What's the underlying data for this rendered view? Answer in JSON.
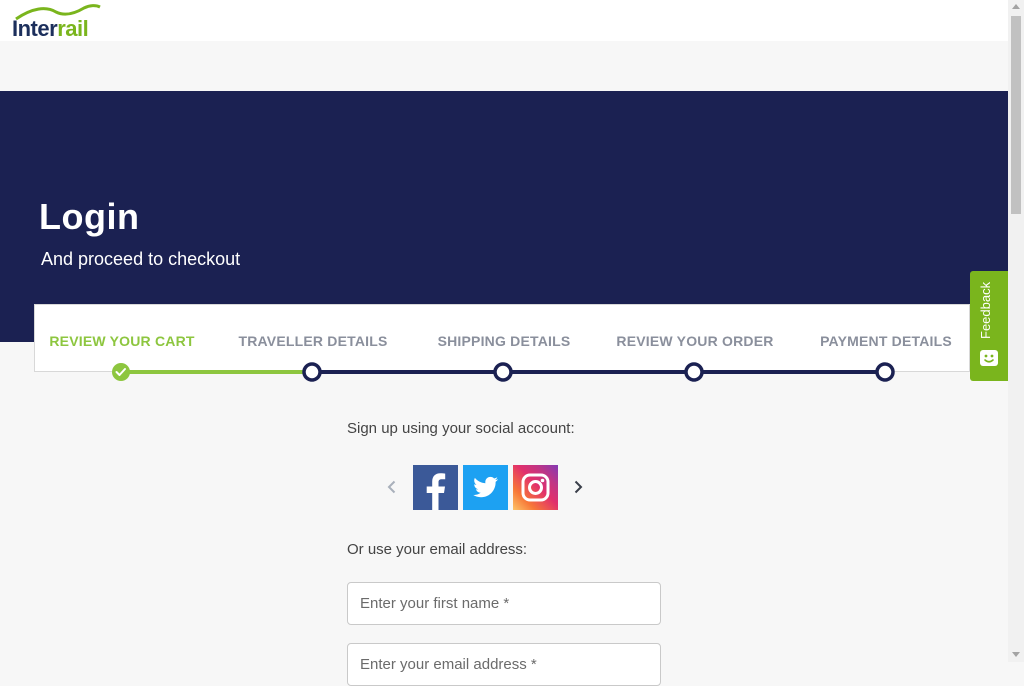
{
  "brand": {
    "logo_text_1": "Inter",
    "logo_text_2": "rail",
    "green": "#7ab51d",
    "navy": "#1b2152"
  },
  "hero": {
    "title": "Login",
    "subtitle": "And proceed to checkout"
  },
  "steps": [
    {
      "label": "REVIEW YOUR CART",
      "state": "completed"
    },
    {
      "label": "TRAVELLER DETAILS",
      "state": "pending"
    },
    {
      "label": "SHIPPING DETAILS",
      "state": "pending"
    },
    {
      "label": "REVIEW YOUR ORDER",
      "state": "pending"
    },
    {
      "label": "PAYMENT DETAILS",
      "state": "pending"
    }
  ],
  "feedback": {
    "label": "Feedback",
    "icon": "smiley-face-icon"
  },
  "social": {
    "label": "Sign up using your social account:",
    "providers": [
      "facebook-icon",
      "twitter-icon",
      "instagram-icon"
    ]
  },
  "email": {
    "label": "Or use your email address:",
    "first_name_placeholder": "Enter your first name *",
    "email_placeholder": "Enter your email address *"
  }
}
